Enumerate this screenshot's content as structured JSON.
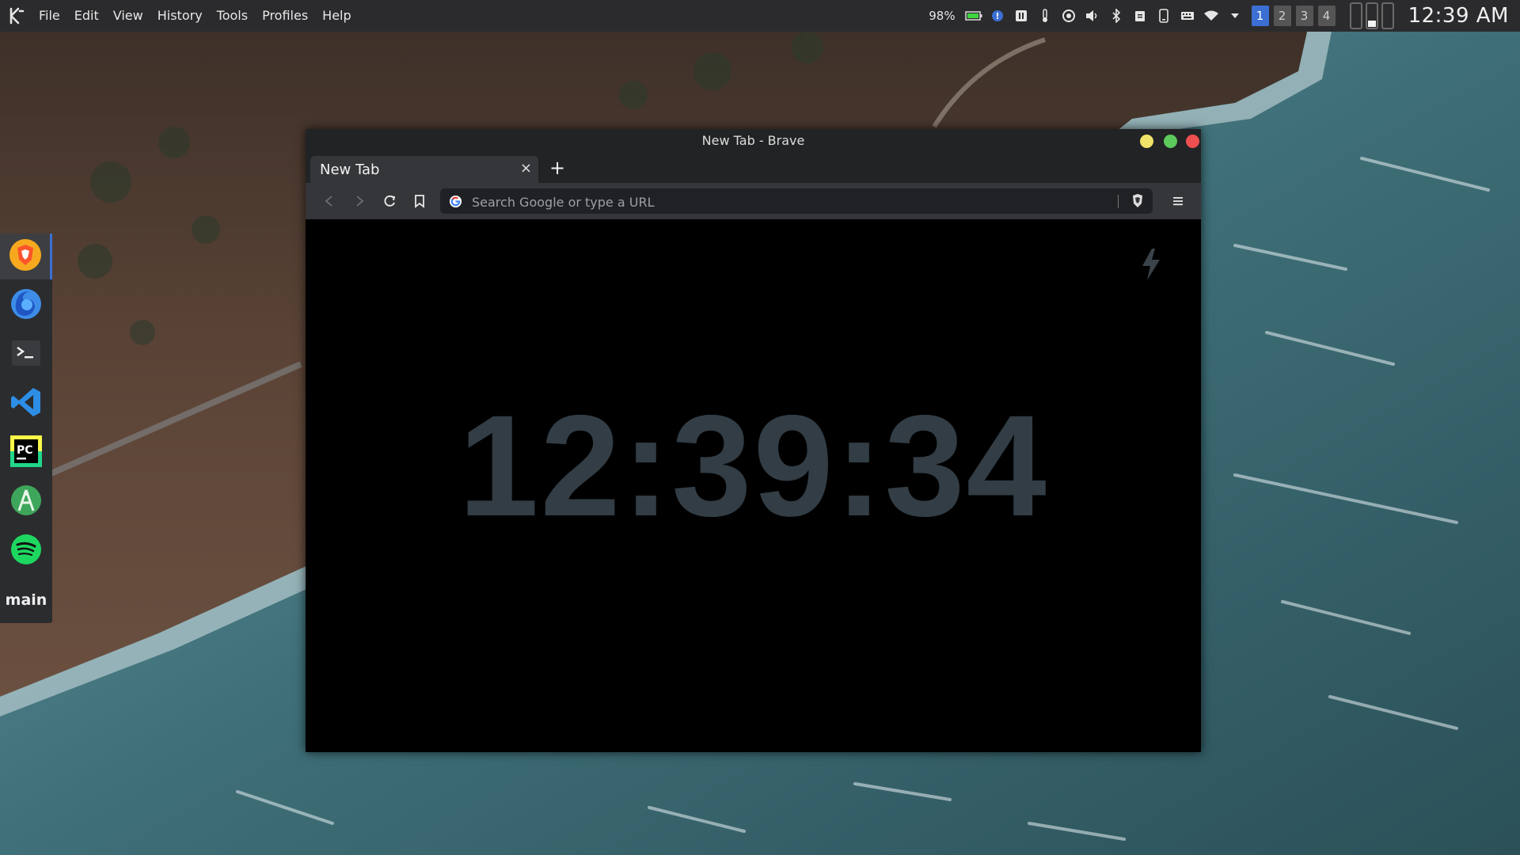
{
  "menubar": {
    "items": [
      "File",
      "Edit",
      "View",
      "History",
      "Tools",
      "Profiles",
      "Help"
    ]
  },
  "tray": {
    "battery": "98%",
    "desktops": [
      "1",
      "2",
      "3",
      "4"
    ],
    "active_desktop": "1",
    "clock": "12:39 AM",
    "icons": [
      "battery-icon",
      "info-icon",
      "pause-icon",
      "temperature-icon",
      "sync-icon",
      "volume-icon",
      "bluetooth-icon",
      "clipboard-icon",
      "phone-icon",
      "keyboard-icon",
      "wifi-icon",
      "expand-arrow-icon"
    ]
  },
  "dock": {
    "apps": [
      "Brave",
      "Firefox",
      "Konsole",
      "Visual Studio Code",
      "PyCharm",
      "Android Studio",
      "Spotify"
    ],
    "label": "main"
  },
  "browser": {
    "window_title": "New Tab - Brave",
    "tab_title": "New Tab",
    "tab_close": "×",
    "new_tab": "+",
    "omnibox_placeholder": "Search Google or type a URL",
    "clock_display": "12:39:34"
  },
  "colors": {
    "panel_bg": "#2b2b2d",
    "accent": "#3b6fd4",
    "clock_text": "#323d45",
    "minimize": "#f0e36a",
    "maximize": "#5ec95c",
    "close": "#ee4f4f"
  }
}
